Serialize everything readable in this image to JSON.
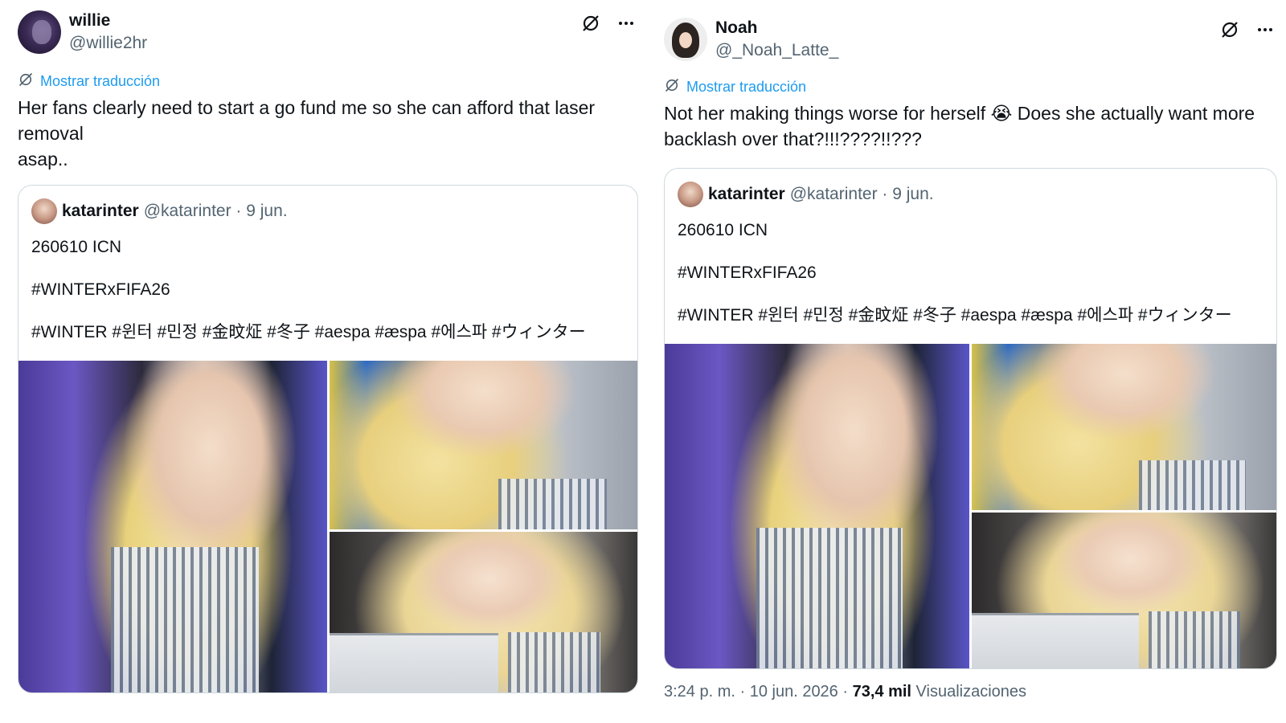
{
  "tweets": [
    {
      "author_name": "willie",
      "author_handle": "@willie2hr",
      "translate_label": "Mostrar traducción",
      "text": "Her fans clearly need to start a go fund me so she can afford that laser removal\nasap..",
      "quote": {
        "author_name": "katarinter",
        "meta": "@katarinter · 9 jun.",
        "lines": [
          "260610 ICN",
          "#WINTERxFIFA26",
          "#WINTER #윈터 #민정 #金旼炡 #冬子 #aespa #æspa #에스파 #ウィンター"
        ]
      }
    },
    {
      "author_name": "Noah",
      "author_handle": "@_Noah_Latte_",
      "translate_label": "Mostrar traducción",
      "text": "Not her making things worse for herself 😭 Does she actually want more backlash over that?!!!????!!???",
      "quote": {
        "author_name": "katarinter",
        "meta": "@katarinter · 9 jun.",
        "lines": [
          "260610 ICN",
          "#WINTERxFIFA26",
          "#WINTER #윈터 #민정 #金旼炡 #冬子 #aespa #æspa #에스파 #ウィンター"
        ]
      }
    }
  ],
  "footer": {
    "timestamp": "3:24 p. m. · 10 jun. 2026 · ",
    "views_count": "73,4 mil",
    "views_label": " Visualizaciones"
  },
  "icons": [
    "grok-icon",
    "more-icon",
    "translate-icon"
  ],
  "colors": {
    "link": "#1d9bf0",
    "secondary_text": "#536471",
    "border": "#cfd9de"
  }
}
